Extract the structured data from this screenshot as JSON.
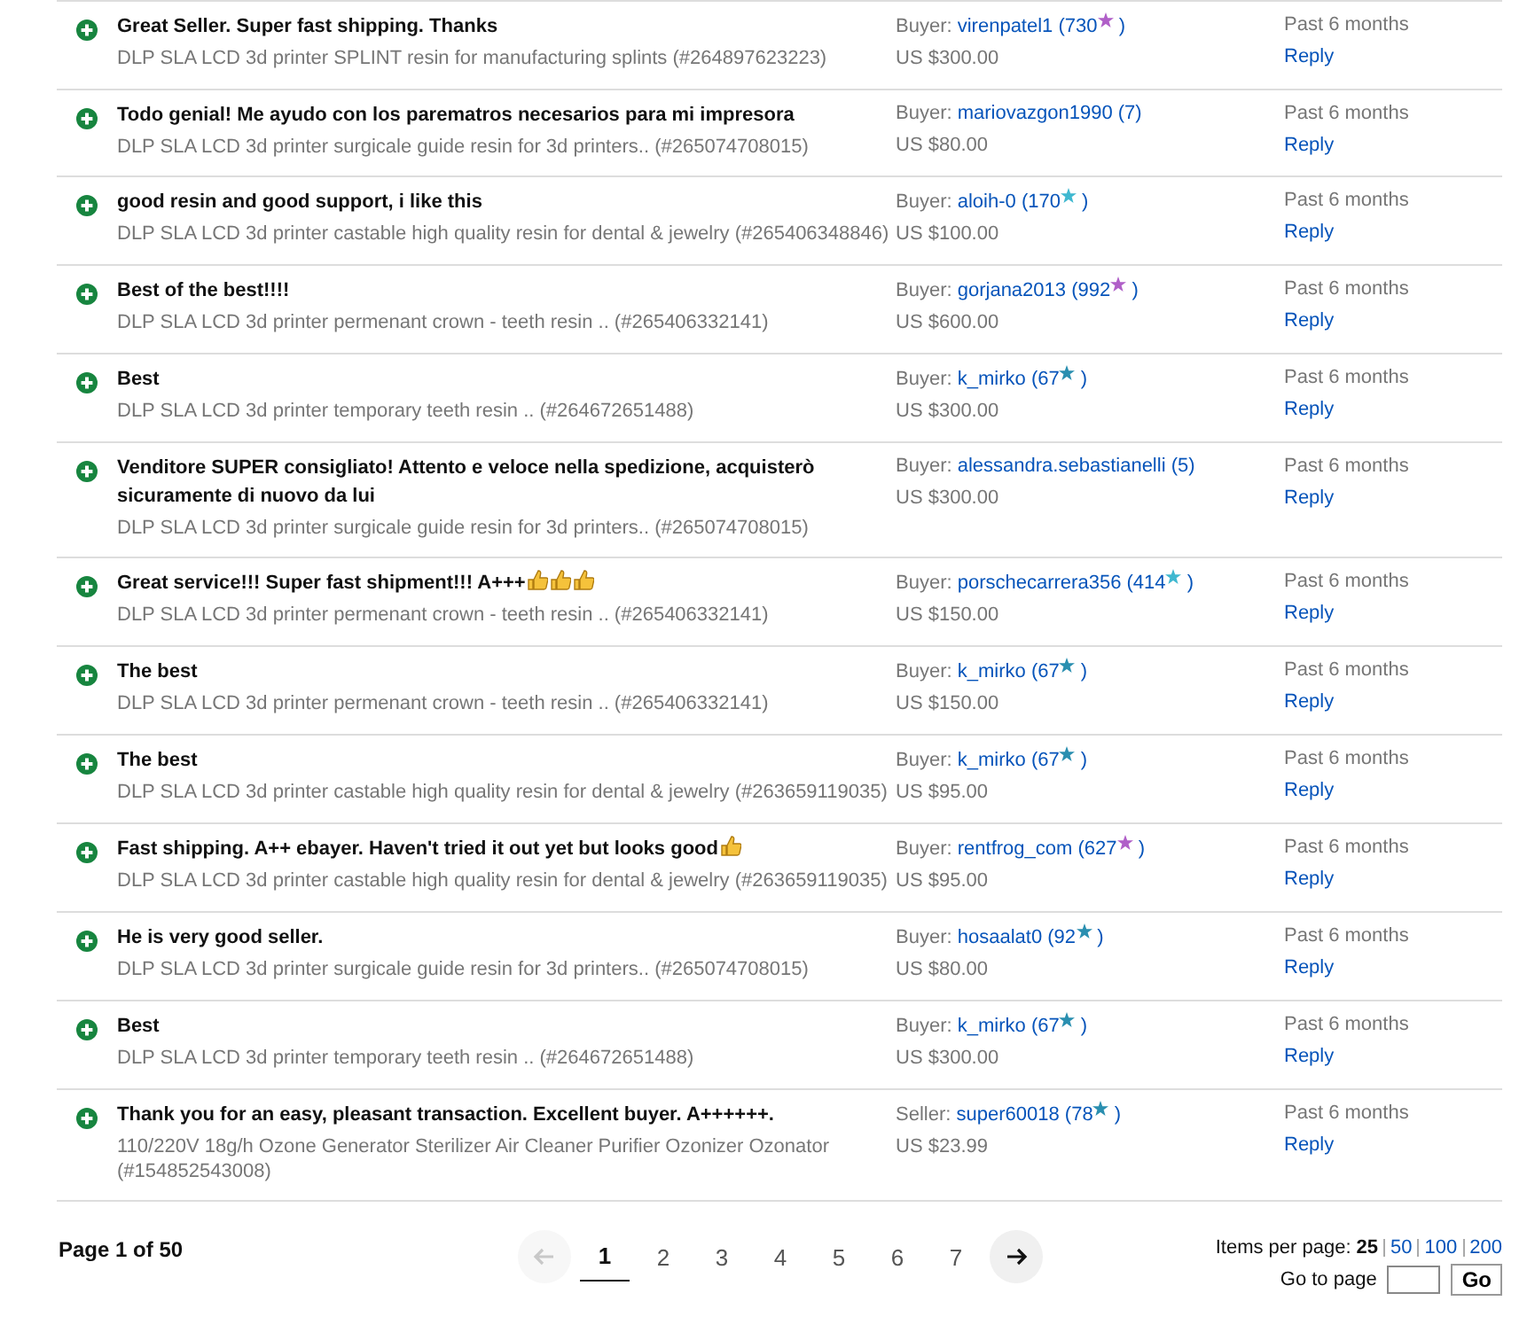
{
  "feedback": [
    {
      "comment": "Great Seller. Super fast shipping. Thanks",
      "item": "DLP SLA LCD 3d printer SPLINT resin for manufacturing splints (#264897623223)",
      "role": "Buyer:",
      "user": "virenpatel1",
      "score": "(730",
      "color": "#b05fc8",
      "score_close": ")",
      "amount": "US $300.00",
      "when": "Past 6 months",
      "action": "Reply"
    },
    {
      "comment": "Todo genial! Me ayudo con los parematros necesarios para mi impresora",
      "item": "DLP SLA LCD 3d printer surgicale guide resin for 3d printers.. (#265074708015)",
      "role": "Buyer:",
      "user": "mariovazgon1990",
      "score": "(7)",
      "amount": "US $80.00",
      "when": "Past 6 months",
      "action": "Reply"
    },
    {
      "comment": "good resin and good support, i like this",
      "item": "DLP SLA LCD 3d printer castable high quality resin for dental & jewelry (#265406348846)",
      "role": "Buyer:",
      "user": "aloih-0",
      "score": "(170",
      "color": "#3fb8d0",
      "score_close": ")",
      "amount": "US $100.00",
      "when": "Past 6 months",
      "action": "Reply"
    },
    {
      "comment": "Best of the best!!!!",
      "item": "DLP SLA LCD 3d printer permenant crown - teeth resin .. (#265406332141)",
      "role": "Buyer:",
      "user": "gorjana2013",
      "score": "(992",
      "color": "#b05fc8",
      "score_close": ")",
      "amount": "US $600.00",
      "when": "Past 6 months",
      "action": "Reply"
    },
    {
      "comment": "Best",
      "item": "DLP SLA LCD 3d printer temporary teeth resin .. (#264672651488)",
      "role": "Buyer:",
      "user": "k_mirko",
      "score": "(67",
      "color": "#2a8fb0",
      "score_close": ")",
      "amount": "US $300.00",
      "when": "Past 6 months",
      "action": "Reply"
    },
    {
      "comment": "Venditore SUPER consigliato! Attento e veloce nella spedizione, acquisterò sicuramente di nuovo da lui",
      "item": "DLP SLA LCD 3d printer surgicale guide resin for 3d printers.. (#265074708015)",
      "role": "Buyer:",
      "user": "alessandra.sebastianelli",
      "score": "(5)",
      "amount": "US $300.00",
      "when": "Past 6 months",
      "action": "Reply"
    },
    {
      "comment": "Great service!!! Super fast shipment!!! A+++",
      "emojis": [
        {
          "kind": "thumbs-up"
        },
        {
          "kind": "thumbs-up"
        },
        {
          "kind": "thumbs-up"
        }
      ],
      "item": "DLP SLA LCD 3d printer permenant crown - teeth resin .. (#265406332141)",
      "role": "Buyer:",
      "user": "porschecarrera356",
      "score": "(414",
      "color": "#3fb8d0",
      "score_close": ")",
      "amount": "US $150.00",
      "when": "Past 6 months",
      "action": "Reply"
    },
    {
      "comment": "The best",
      "item": "DLP SLA LCD 3d printer permenant crown - teeth resin .. (#265406332141)",
      "role": "Buyer:",
      "user": "k_mirko",
      "score": "(67",
      "color": "#2a8fb0",
      "score_close": ")",
      "amount": "US $150.00",
      "when": "Past 6 months",
      "action": "Reply"
    },
    {
      "comment": "The best",
      "item": "DLP SLA LCD 3d printer castable high quality resin for dental & jewelry (#263659119035)",
      "role": "Buyer:",
      "user": "k_mirko",
      "score": "(67",
      "color": "#2a8fb0",
      "score_close": ")",
      "amount": "US $95.00",
      "when": "Past 6 months",
      "action": "Reply"
    },
    {
      "comment": "Fast shipping. A++ ebayer. Haven't tried it out yet but looks good",
      "emojis": [
        {
          "kind": "thumbs-up"
        }
      ],
      "item": "DLP SLA LCD 3d printer castable high quality resin for dental & jewelry (#263659119035)",
      "role": "Buyer:",
      "user": "rentfrog_com",
      "score": "(627",
      "color": "#b05fc8",
      "score_close": ")",
      "amount": "US $95.00",
      "when": "Past 6 months",
      "action": "Reply"
    },
    {
      "comment": "He is very good seller.",
      "item": "DLP SLA LCD 3d printer surgicale guide resin for 3d printers.. (#265074708015)",
      "role": "Buyer:",
      "user": "hosaalat0",
      "score": "(92",
      "color": "#2a8fb0",
      "score_close": ")",
      "amount": "US $80.00",
      "when": "Past 6 months",
      "action": "Reply"
    },
    {
      "comment": "Best",
      "item": "DLP SLA LCD 3d printer temporary teeth resin .. (#264672651488)",
      "role": "Buyer:",
      "user": "k_mirko",
      "score": "(67",
      "color": "#2a8fb0",
      "score_close": ")",
      "amount": "US $300.00",
      "when": "Past 6 months",
      "action": "Reply"
    },
    {
      "comment": "Thank you for an easy, pleasant transaction. Excellent buyer. A++++++.",
      "item": "110/220V 18g/h Ozone Generator Sterilizer Air Cleaner Purifier Ozonizer Ozonator (#154852543008)",
      "role": "Seller:",
      "user": "super60018",
      "score": "(78",
      "color": "#2a8fb0",
      "score_close": ")",
      "amount": "US $23.99",
      "when": "Past 6 months",
      "action": "Reply"
    }
  ],
  "footer": {
    "page_label": "Page **1** of **50**",
    "prev": {
      "disabled": true
    },
    "next": {
      "disabled": false
    },
    "pages": [
      {
        "label": "1",
        "selected": true
      },
      {
        "label": "2",
        "selected": false
      },
      {
        "label": "3",
        "selected": false
      },
      {
        "label": "4",
        "selected": false
      },
      {
        "label": "5",
        "selected": false
      },
      {
        "label": "6",
        "selected": false
      },
      {
        "label": "7",
        "selected": false
      }
    ],
    "items_per_page_label": "Items per page:",
    "page_sizes": [
      {
        "label": "25",
        "selected": true
      },
      {
        "label": "50",
        "selected": false
      },
      {
        "label": "100",
        "selected": false
      },
      {
        "label": "200",
        "selected": false
      }
    ],
    "goto_label": "Go to page",
    "go_button": "Go"
  }
}
